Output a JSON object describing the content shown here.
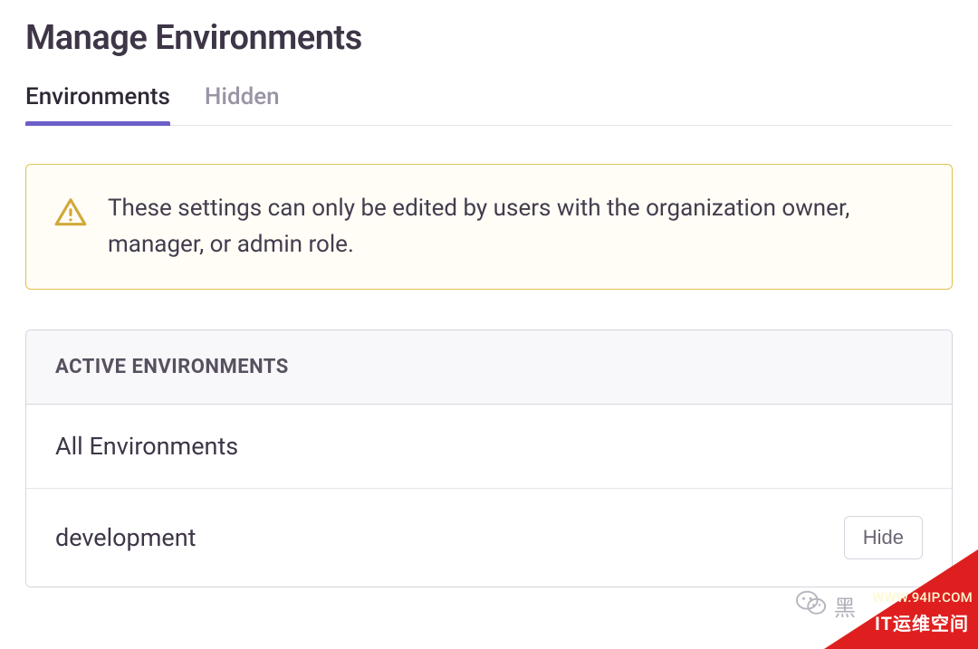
{
  "header": {
    "title": "Manage Environments"
  },
  "tabs": {
    "items": [
      {
        "label": "Environments",
        "active": true
      },
      {
        "label": "Hidden",
        "active": false
      }
    ]
  },
  "alert": {
    "text": "These settings can only be edited by users with the organization owner, manager, or admin role."
  },
  "panel": {
    "header": "ACTIVE ENVIRONMENTS",
    "rows": [
      {
        "name": "All Environments",
        "has_hide": false
      },
      {
        "name": "development",
        "has_hide": true,
        "hide_label": "Hide"
      }
    ]
  },
  "watermark": {
    "wechat_text": "黑",
    "url": "WWW.94IP.COM",
    "brand": "IT运维空间"
  }
}
